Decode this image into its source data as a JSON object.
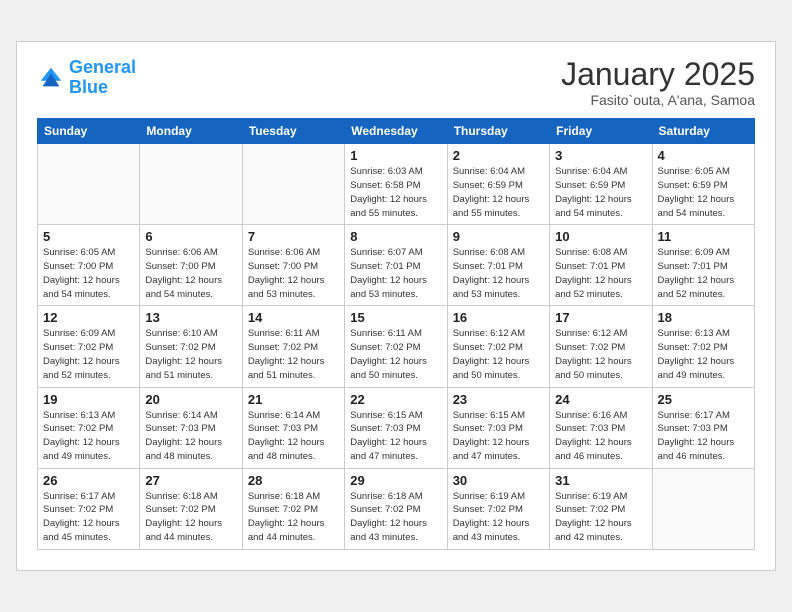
{
  "header": {
    "logo_general": "General",
    "logo_blue": "Blue",
    "month_year": "January 2025",
    "location": "Fasito`outa, A'ana, Samoa"
  },
  "weekdays": [
    "Sunday",
    "Monday",
    "Tuesday",
    "Wednesday",
    "Thursday",
    "Friday",
    "Saturday"
  ],
  "weeks": [
    [
      {
        "day": "",
        "info": ""
      },
      {
        "day": "",
        "info": ""
      },
      {
        "day": "",
        "info": ""
      },
      {
        "day": "1",
        "info": "Sunrise: 6:03 AM\nSunset: 6:58 PM\nDaylight: 12 hours\nand 55 minutes."
      },
      {
        "day": "2",
        "info": "Sunrise: 6:04 AM\nSunset: 6:59 PM\nDaylight: 12 hours\nand 55 minutes."
      },
      {
        "day": "3",
        "info": "Sunrise: 6:04 AM\nSunset: 6:59 PM\nDaylight: 12 hours\nand 54 minutes."
      },
      {
        "day": "4",
        "info": "Sunrise: 6:05 AM\nSunset: 6:59 PM\nDaylight: 12 hours\nand 54 minutes."
      }
    ],
    [
      {
        "day": "5",
        "info": "Sunrise: 6:05 AM\nSunset: 7:00 PM\nDaylight: 12 hours\nand 54 minutes."
      },
      {
        "day": "6",
        "info": "Sunrise: 6:06 AM\nSunset: 7:00 PM\nDaylight: 12 hours\nand 54 minutes."
      },
      {
        "day": "7",
        "info": "Sunrise: 6:06 AM\nSunset: 7:00 PM\nDaylight: 12 hours\nand 53 minutes."
      },
      {
        "day": "8",
        "info": "Sunrise: 6:07 AM\nSunset: 7:01 PM\nDaylight: 12 hours\nand 53 minutes."
      },
      {
        "day": "9",
        "info": "Sunrise: 6:08 AM\nSunset: 7:01 PM\nDaylight: 12 hours\nand 53 minutes."
      },
      {
        "day": "10",
        "info": "Sunrise: 6:08 AM\nSunset: 7:01 PM\nDaylight: 12 hours\nand 52 minutes."
      },
      {
        "day": "11",
        "info": "Sunrise: 6:09 AM\nSunset: 7:01 PM\nDaylight: 12 hours\nand 52 minutes."
      }
    ],
    [
      {
        "day": "12",
        "info": "Sunrise: 6:09 AM\nSunset: 7:02 PM\nDaylight: 12 hours\nand 52 minutes."
      },
      {
        "day": "13",
        "info": "Sunrise: 6:10 AM\nSunset: 7:02 PM\nDaylight: 12 hours\nand 51 minutes."
      },
      {
        "day": "14",
        "info": "Sunrise: 6:11 AM\nSunset: 7:02 PM\nDaylight: 12 hours\nand 51 minutes."
      },
      {
        "day": "15",
        "info": "Sunrise: 6:11 AM\nSunset: 7:02 PM\nDaylight: 12 hours\nand 50 minutes."
      },
      {
        "day": "16",
        "info": "Sunrise: 6:12 AM\nSunset: 7:02 PM\nDaylight: 12 hours\nand 50 minutes."
      },
      {
        "day": "17",
        "info": "Sunrise: 6:12 AM\nSunset: 7:02 PM\nDaylight: 12 hours\nand 50 minutes."
      },
      {
        "day": "18",
        "info": "Sunrise: 6:13 AM\nSunset: 7:02 PM\nDaylight: 12 hours\nand 49 minutes."
      }
    ],
    [
      {
        "day": "19",
        "info": "Sunrise: 6:13 AM\nSunset: 7:02 PM\nDaylight: 12 hours\nand 49 minutes."
      },
      {
        "day": "20",
        "info": "Sunrise: 6:14 AM\nSunset: 7:03 PM\nDaylight: 12 hours\nand 48 minutes."
      },
      {
        "day": "21",
        "info": "Sunrise: 6:14 AM\nSunset: 7:03 PM\nDaylight: 12 hours\nand 48 minutes."
      },
      {
        "day": "22",
        "info": "Sunrise: 6:15 AM\nSunset: 7:03 PM\nDaylight: 12 hours\nand 47 minutes."
      },
      {
        "day": "23",
        "info": "Sunrise: 6:15 AM\nSunset: 7:03 PM\nDaylight: 12 hours\nand 47 minutes."
      },
      {
        "day": "24",
        "info": "Sunrise: 6:16 AM\nSunset: 7:03 PM\nDaylight: 12 hours\nand 46 minutes."
      },
      {
        "day": "25",
        "info": "Sunrise: 6:17 AM\nSunset: 7:03 PM\nDaylight: 12 hours\nand 46 minutes."
      }
    ],
    [
      {
        "day": "26",
        "info": "Sunrise: 6:17 AM\nSunset: 7:02 PM\nDaylight: 12 hours\nand 45 minutes."
      },
      {
        "day": "27",
        "info": "Sunrise: 6:18 AM\nSunset: 7:02 PM\nDaylight: 12 hours\nand 44 minutes."
      },
      {
        "day": "28",
        "info": "Sunrise: 6:18 AM\nSunset: 7:02 PM\nDaylight: 12 hours\nand 44 minutes."
      },
      {
        "day": "29",
        "info": "Sunrise: 6:18 AM\nSunset: 7:02 PM\nDaylight: 12 hours\nand 43 minutes."
      },
      {
        "day": "30",
        "info": "Sunrise: 6:19 AM\nSunset: 7:02 PM\nDaylight: 12 hours\nand 43 minutes."
      },
      {
        "day": "31",
        "info": "Sunrise: 6:19 AM\nSunset: 7:02 PM\nDaylight: 12 hours\nand 42 minutes."
      },
      {
        "day": "",
        "info": ""
      }
    ]
  ]
}
